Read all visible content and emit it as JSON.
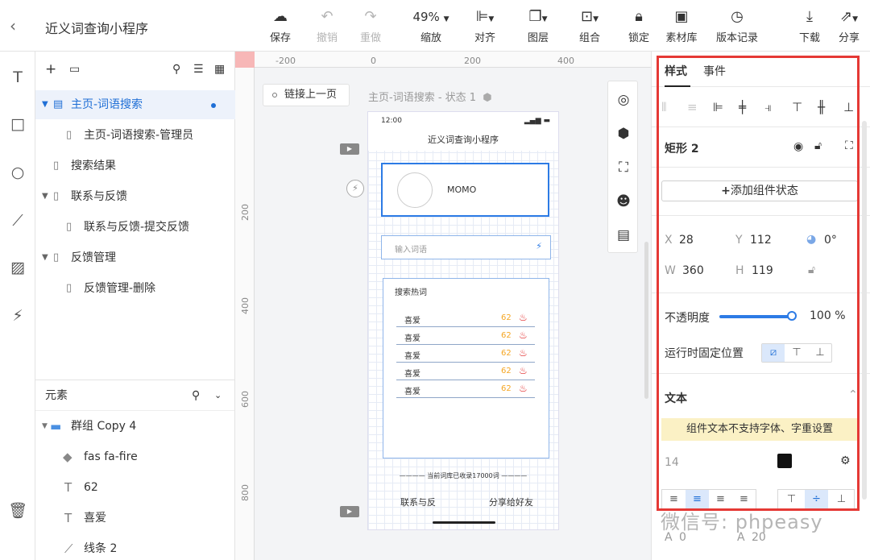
{
  "app": {
    "title": "近义词查询小程序"
  },
  "toolbar": {
    "save": "保存",
    "undo": "撤销",
    "redo": "重做",
    "zoom_value": "49%",
    "zoom": "缩放",
    "align": "对齐",
    "layer": "图层",
    "group": "组合",
    "lock": "锁定",
    "assets": "素材库",
    "history": "版本记录",
    "download": "下载",
    "share": "分享"
  },
  "pages": {
    "items": [
      {
        "label": "主页-词语搜索"
      },
      {
        "label": "主页-词语搜索-管理员"
      },
      {
        "label": "搜索结果"
      },
      {
        "label": "联系与反馈"
      },
      {
        "label": "联系与反馈-提交反馈"
      },
      {
        "label": "反馈管理"
      },
      {
        "label": "反馈管理-删除"
      }
    ]
  },
  "elements": {
    "title": "元素",
    "items": [
      {
        "label": "群组 Copy 4"
      },
      {
        "label": "fas fa-fire"
      },
      {
        "label": "62"
      },
      {
        "label": "喜爱"
      },
      {
        "label": "线条 2"
      }
    ]
  },
  "canvas": {
    "ruler_h": [
      "-200",
      "0",
      "200",
      "400"
    ],
    "ruler_v": [
      "200",
      "400",
      "600",
      "800"
    ],
    "back_link": "链接上一页",
    "state_label": "主页-词语搜索 - 状态 1"
  },
  "phone": {
    "time": "12:00",
    "title": "近义词查询小程序",
    "user_name": "MOMO",
    "search_placeholder": "输入词语",
    "hot_title": "搜索热词",
    "hot_rows": [
      {
        "word": "喜爱",
        "count": "62"
      },
      {
        "word": "喜爱",
        "count": "62"
      },
      {
        "word": "喜爱",
        "count": "62"
      },
      {
        "word": "喜爱",
        "count": "62"
      },
      {
        "word": "喜爱",
        "count": "62"
      }
    ],
    "count_text": "当前词库已收录17000词",
    "nav_contact": "联系与反",
    "nav_share": "分享给好友"
  },
  "props": {
    "tab_style": "样式",
    "tab_event": "事件",
    "element_name": "矩形 2",
    "add_state": "添加组件状态",
    "x_label": "X",
    "x_value": "28",
    "y_label": "Y",
    "y_value": "112",
    "rotation": "0°",
    "w_label": "W",
    "w_value": "360",
    "h_label": "H",
    "h_value": "119",
    "opacity_label": "不透明度",
    "opacity_value": "100",
    "opacity_unit": "%",
    "fixed_label": "运行时固定位置",
    "text_section": "文本",
    "warning": "组件文本不支持字体、字重设置",
    "font_size": "14",
    "text_color": "#111111",
    "letter_spacing": "0",
    "line_height": "20"
  },
  "watermark": "微信号: phpeasy",
  "colors": {
    "accent": "#2d7be5",
    "highlight": "#e53935",
    "fire": "#e02020",
    "count": "#f5a623"
  }
}
